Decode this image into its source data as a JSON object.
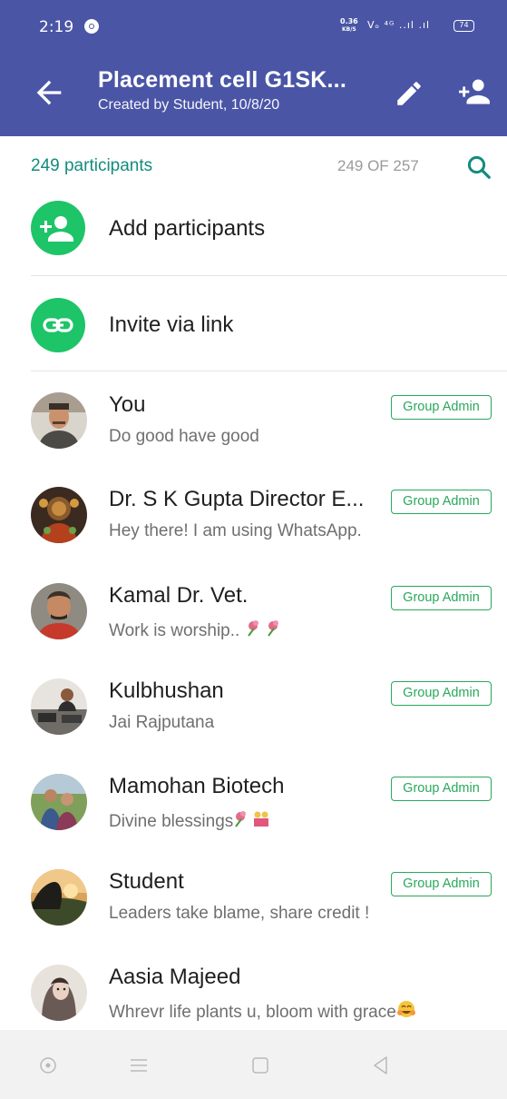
{
  "status_bar": {
    "time": "2:19",
    "net_speed_top": "0.36",
    "net_speed_unit": "KB/S",
    "network": "Vo LTE 4G",
    "battery": "74"
  },
  "header": {
    "title": "Placement cell G1SK...",
    "subtitle": "Created by Student, 10/8/20"
  },
  "participants_header": {
    "count_label": "249 participants",
    "of_label": "249 OF 257"
  },
  "actions": {
    "add_label": "Add participants",
    "invite_label": "Invite via link"
  },
  "admin_badge_label": "Group Admin",
  "participants": [
    {
      "name": "You",
      "status": "Do good have good",
      "admin": true
    },
    {
      "name": "Dr. S K Gupta Director E...",
      "status": "Hey there! I am using WhatsApp.",
      "admin": true
    },
    {
      "name": "Kamal Dr. Vet.",
      "status": "Work is worship.. ",
      "admin": true
    },
    {
      "name": "Kulbhushan",
      "status": "Jai Rajputana",
      "admin": true
    },
    {
      "name": "Mamohan Biotech",
      "status": "Divine blessings",
      "admin": true
    },
    {
      "name": "Student",
      "status": "Leaders take blame, share credit !",
      "admin": true
    },
    {
      "name": "Aasia Majeed",
      "status": "Whrevr life plants u, bloom with grace",
      "admin": false
    }
  ],
  "colors": {
    "app_bar": "#4a55a6",
    "accent_green": "#1ec468",
    "teal_text": "#128c7e",
    "badge_green": "#29a85c"
  },
  "icons": [
    "back-arrow-icon",
    "edit-pencil-icon",
    "add-person-icon",
    "search-icon",
    "link-icon",
    "circle-nav-icon",
    "menu-nav-icon",
    "home-square-icon",
    "back-triangle-icon"
  ]
}
